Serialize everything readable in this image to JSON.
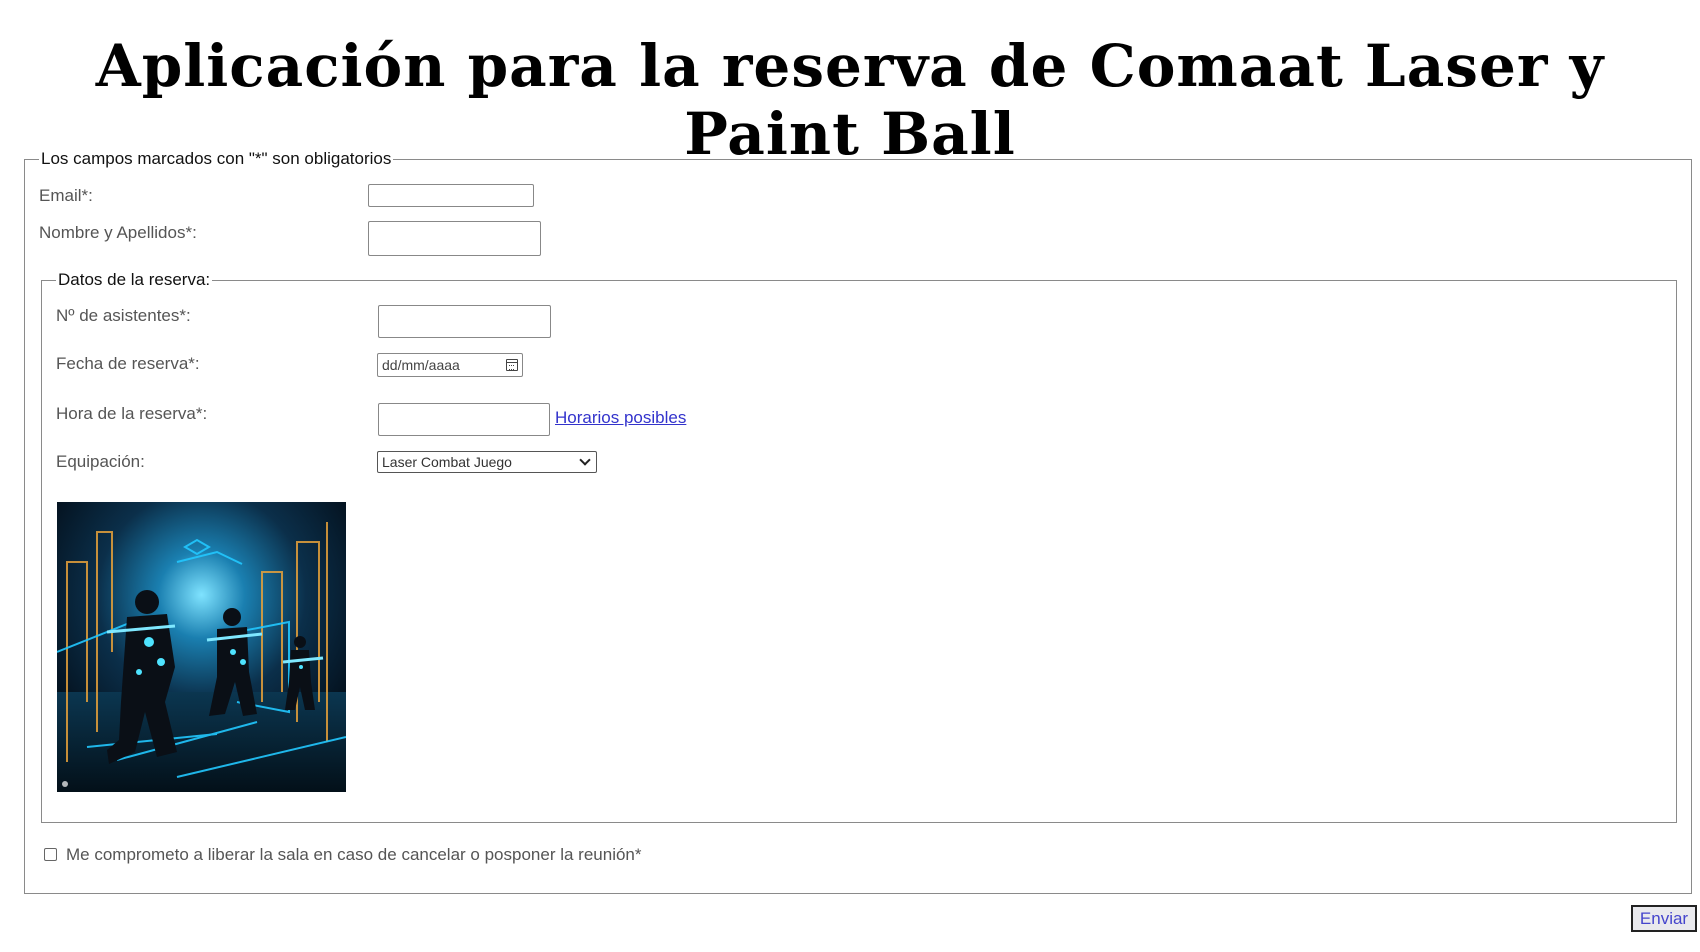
{
  "page": {
    "title": "Aplicación para la reserva de Comaat Laser y Paint Ball"
  },
  "form": {
    "legend": "Los campos marcados con \"*\" son obligatorios",
    "email_label": "Email*:",
    "email_value": "",
    "name_label": "Nombre y Apellidos*:",
    "name_value": "",
    "reservation": {
      "legend": "Datos de la reserva:",
      "attendees_label": "Nº de asistentes*:",
      "attendees_value": "",
      "date_label": "Fecha de reserva*:",
      "date_placeholder": "dd/mm/aaaa",
      "date_icon": "calendar-icon",
      "time_label": "Hora de la reserva*:",
      "time_value": "",
      "schedule_link": "Horarios posibles",
      "equipment_label": "Equipación:",
      "equipment_selected": "Laser Combat Juego",
      "image_alt": "laser-combat-scene"
    },
    "commitment_label": "Me comprometo a liberar la sala en caso de cancelar o posponer la reunión*",
    "commitment_checked": false,
    "submit_label": "Enviar"
  },
  "colors": {
    "link": "#3333cc",
    "border": "#8a8a8a",
    "neon": "#22c8ff",
    "neon_accent": "#e8a23a"
  }
}
